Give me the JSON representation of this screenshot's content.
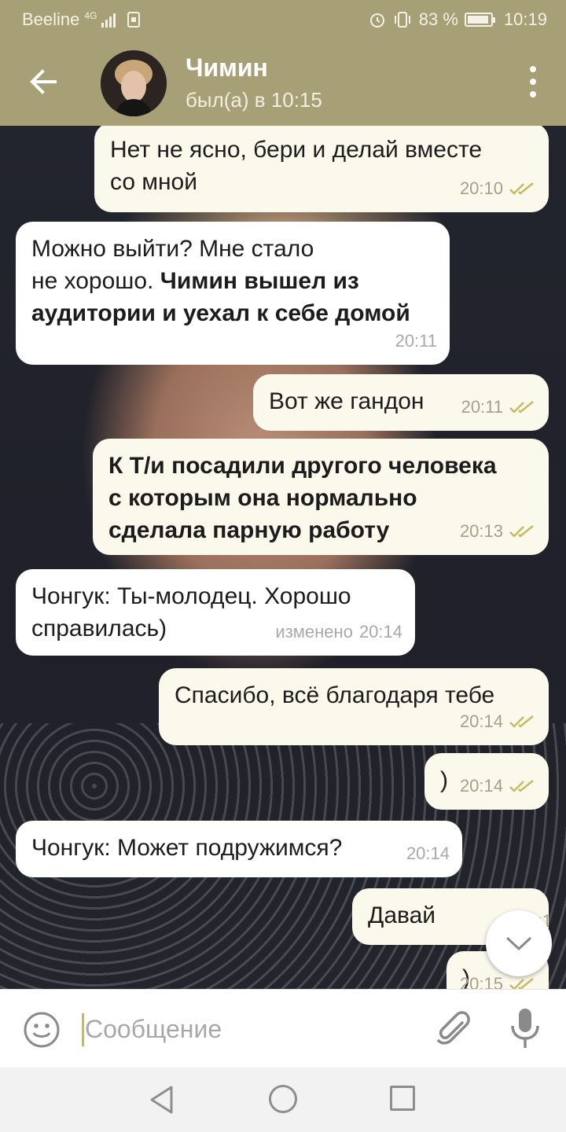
{
  "status_bar": {
    "carrier": "Beeline",
    "network": "4G",
    "battery": "83 %",
    "battery_level": 0.83,
    "time": "10:19"
  },
  "header": {
    "contact_name": "Чимин",
    "last_seen": "был(а) в 10:15"
  },
  "messages": [
    {
      "direction": "out",
      "text": "Нет не ясно, бери и делай вместе\nсо мной",
      "time": "20:10",
      "read": true
    },
    {
      "direction": "in",
      "text_plain": "Можно выйти? Мне стало\nне хорошо. ",
      "text_bold": "Чимин вышел из\nаудитории и уехал к себе домой",
      "time": "20:11"
    },
    {
      "direction": "out",
      "text": "Вот же гандон",
      "time": "20:11",
      "read": true
    },
    {
      "direction": "out",
      "text_bold": "К Т/и посадили другого человека\nс которым она нормально\nсделала парную работу",
      "time": "20:13",
      "read": true
    },
    {
      "direction": "in",
      "text": "Чонгук: Ты-молодец. Хорошо\nсправилась)",
      "edited": "изменено",
      "time": "20:14"
    },
    {
      "direction": "out",
      "text": "Спасибо, всё благодаря тебе",
      "time": "20:14",
      "read": true
    },
    {
      "direction": "out",
      "text": ")",
      "time": "20:14",
      "read": true
    },
    {
      "direction": "in",
      "text": "Чонгук: Может подружимся?",
      "time": "20:14"
    },
    {
      "direction": "out",
      "text": "Давай",
      "time": "20:1",
      "read": true
    },
    {
      "direction": "out",
      "text": ")",
      "time": "20:15",
      "read": true
    }
  ],
  "input": {
    "placeholder": "Сообщение"
  },
  "icons": {
    "back": "arrow-left-icon",
    "menu": "more-vertical-icon",
    "emoji": "smile-icon",
    "attach": "paperclip-icon",
    "mic": "microphone-icon",
    "scroll": "chevron-down-icon"
  },
  "colors": {
    "header": "#a7a076",
    "outgoing_bubble": "#fbf8ec",
    "incoming_bubble": "#ffffff",
    "tick": "#c4bb62"
  }
}
